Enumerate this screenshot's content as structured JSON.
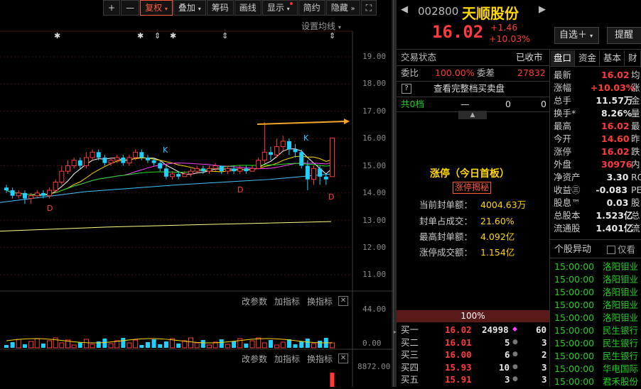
{
  "toolbar": {
    "plus": "+",
    "minus": "—",
    "fuquan": "复权",
    "diejia": "叠加",
    "chouma": "筹码",
    "huaxian": "画线",
    "xianshi": "显示",
    "jianyue": "简约",
    "yincang": "隐藏",
    "expand": "⛶"
  },
  "chart": {
    "settings_ma": "设置均线",
    "y_labels": [
      "19.00",
      "18.00",
      "17.00",
      "16.00",
      "15.00",
      "14.00",
      "13.00",
      "12.00",
      "11.00"
    ],
    "markers": [
      "✱",
      "✱",
      "⇕",
      "✱",
      "⇕",
      "⇕"
    ],
    "annotations": [
      "K",
      "K",
      "D",
      "D",
      "D"
    ],
    "sub1": {
      "gaicanshu": "改参数",
      "jiazhibiao": "加指标",
      "huanzhibiao": "换指标",
      "close": "✕",
      "y_top": "44.00",
      "y_bottom": "0.00"
    },
    "sub2": {
      "gaicanshu": "改参数",
      "jiazhibiao": "加指标",
      "huanzhibiao": "换指标",
      "close": "✕",
      "y_top": "8872.00"
    }
  },
  "stock": {
    "code": "002800",
    "name": "天顺股份",
    "price": "16.02",
    "change": "+1.46",
    "change_pct": "+10.03%",
    "zixuan": "自选＋",
    "tixing": "提醒"
  },
  "status": {
    "label": "交易状态",
    "value": "已收市",
    "weibi_label": "委比",
    "weibi": "100.00%",
    "weicha_label": "委差",
    "weicha": "27832",
    "full_book": "查看完整档买卖盘",
    "total_label": "共0档",
    "dash": "—",
    "zero1": "0",
    "zero2": "0"
  },
  "limit_up": {
    "title": "涨停（今日首板）",
    "reveal": "涨停揭秘",
    "rows": [
      {
        "label": "当前封单额：",
        "value": "4004.63万"
      },
      {
        "label": "封单占成交：",
        "value": "21.60%"
      },
      {
        "label": "最高封单额：",
        "value": "4.092亿"
      },
      {
        "label": "涨停成交额：",
        "value": "1.154亿"
      }
    ]
  },
  "book": {
    "ratio": "100%",
    "rows": [
      {
        "label": "买一",
        "price": "16.02",
        "vol": "24998",
        "count": "60",
        "mark": "◆"
      },
      {
        "label": "买二",
        "price": "16.01",
        "vol": "5",
        "count": "3",
        "mark": "●"
      },
      {
        "label": "买三",
        "price": "16.00",
        "vol": "6",
        "count": "2",
        "mark": "●"
      },
      {
        "label": "买四",
        "price": "15.93",
        "vol": "10",
        "count": "3",
        "mark": "●"
      },
      {
        "label": "买五",
        "price": "15.91",
        "vol": "3",
        "count": "3",
        "mark": "●"
      }
    ]
  },
  "tabs": [
    "盘口",
    "资金",
    "基本",
    "财"
  ],
  "quote": [
    {
      "label": "最新",
      "value": "16.02",
      "extra": "均",
      "color": "red"
    },
    {
      "label": "涨幅",
      "value": "+10.03%",
      "extra": "涨",
      "color": "red"
    },
    {
      "label": "总手",
      "value": "11.57万",
      "extra": "金",
      "color": "white"
    },
    {
      "label": "换手*",
      "value": "8.26%",
      "extra": "量",
      "color": "white"
    },
    {
      "label": "最高",
      "value": "16.02",
      "extra": "最",
      "color": "red"
    },
    {
      "label": "今开",
      "value": "14.60",
      "extra": "昨",
      "color": "red"
    },
    {
      "label": "涨停",
      "value": "16.02",
      "extra": "跌",
      "color": "red"
    },
    {
      "label": "外盘",
      "value": "30976",
      "extra": "内",
      "color": "red"
    },
    {
      "label": "净资产",
      "value": "3.30",
      "extra": "RO",
      "color": "white"
    },
    {
      "label": "收益㊂",
      "value": "-0.083",
      "extra": "PE",
      "color": "white"
    },
    {
      "label": "股息™",
      "value": "0.03",
      "extra": "股",
      "color": "white"
    },
    {
      "label": "总股本",
      "value": "1.523亿",
      "extra": "总",
      "color": "white"
    },
    {
      "label": "流通股",
      "value": "1.401亿",
      "extra": "流",
      "color": "white"
    }
  ],
  "movement": {
    "title": "个股异动",
    "only_me": "仅看",
    "rows": [
      {
        "time": "15:00:00",
        "text": "洛阳钼业"
      },
      {
        "time": "15:00:00",
        "text": "洛阳钼业"
      },
      {
        "time": "15:00:00",
        "text": "洛阳钼业"
      },
      {
        "time": "15:00:00",
        "text": "洛阳钼业"
      },
      {
        "time": "15:00:00",
        "text": "洛阳钼业"
      },
      {
        "time": "15:00:00",
        "text": "民生银行"
      },
      {
        "time": "15:00:00",
        "text": "民生银行"
      },
      {
        "time": "15:00:00",
        "text": "民生银行"
      },
      {
        "time": "15:00:00",
        "text": "华电国际"
      },
      {
        "time": "15:00:00",
        "text": "君禾股份"
      }
    ]
  },
  "colors": {
    "up": "#ff3b3b",
    "down": "#20d0ff",
    "bg": "#000000"
  }
}
